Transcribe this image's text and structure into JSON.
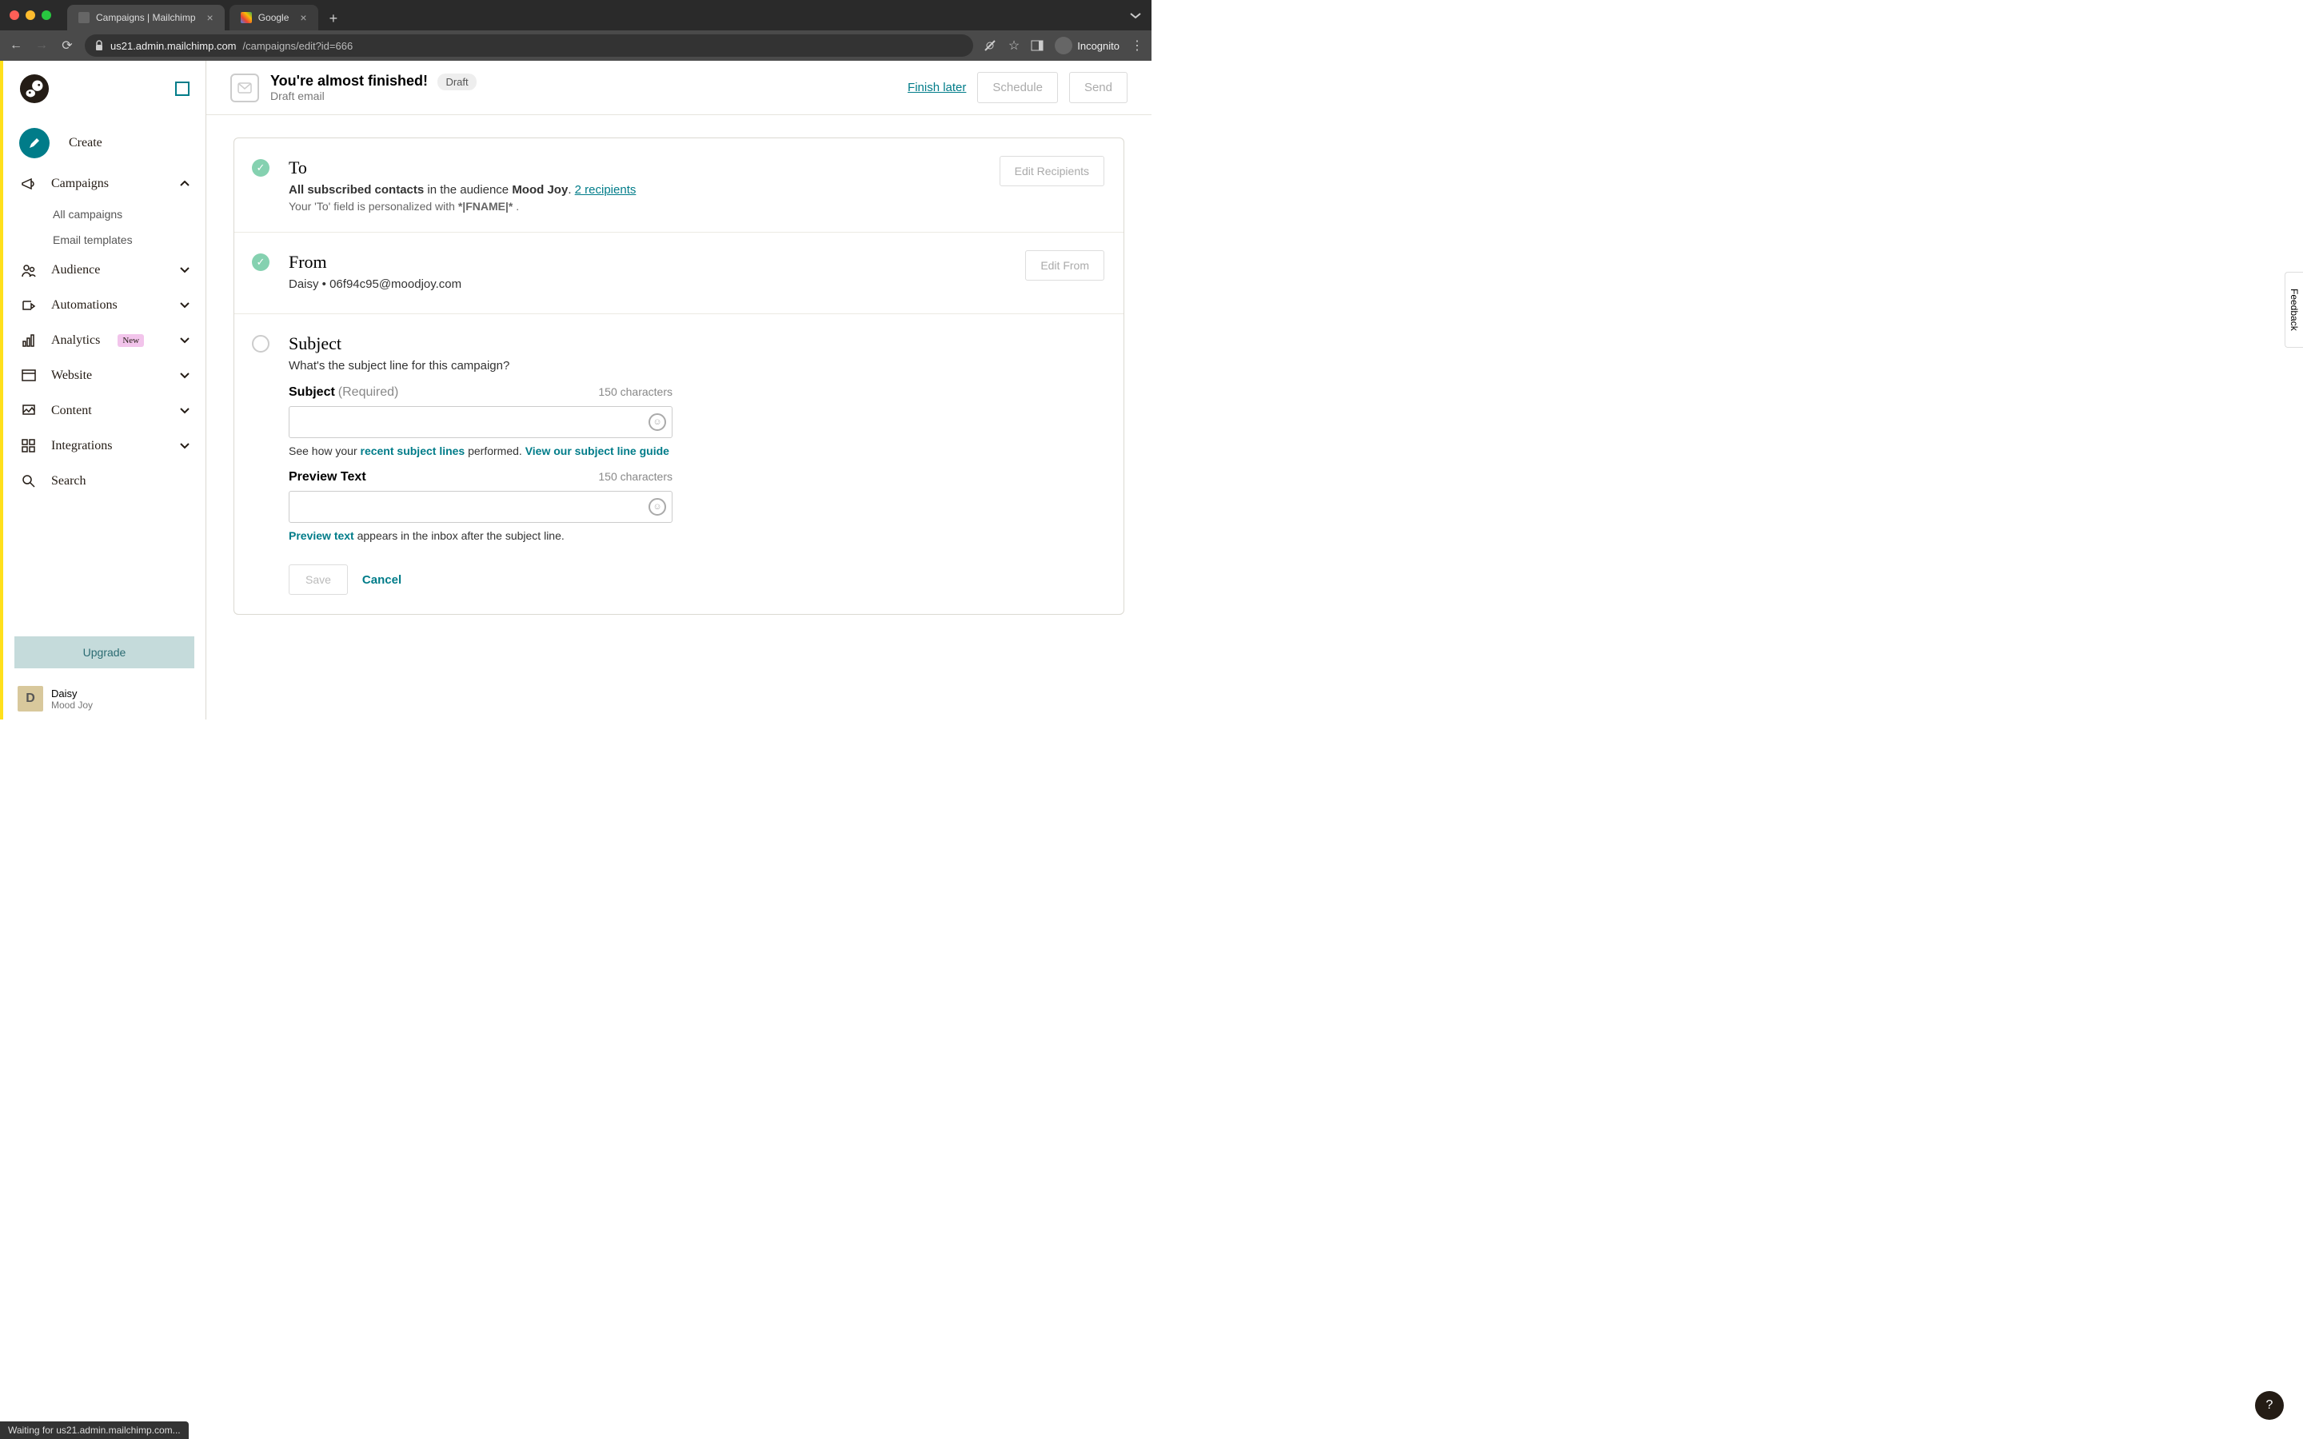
{
  "browser": {
    "tabs": [
      {
        "title": "Campaigns | Mailchimp",
        "active": true
      },
      {
        "title": "Google",
        "active": false
      }
    ],
    "url_prefix": "us21.admin.mailchimp.com",
    "url_path": "/campaigns/edit?id=666",
    "incognito": "Incognito"
  },
  "sidebar": {
    "create": "Create",
    "campaigns": "Campaigns",
    "campaigns_sub": [
      "All campaigns",
      "Email templates"
    ],
    "audience": "Audience",
    "automations": "Automations",
    "analytics": "Analytics",
    "analytics_badge": "New",
    "website": "Website",
    "content": "Content",
    "integrations": "Integrations",
    "search": "Search",
    "upgrade": "Upgrade",
    "user_initial": "D",
    "user_name": "Daisy",
    "user_org": "Mood Joy"
  },
  "header": {
    "title": "You're almost finished!",
    "badge": "Draft",
    "subtitle": "Draft email",
    "finish_later": "Finish later",
    "schedule": "Schedule",
    "send": "Send"
  },
  "to_section": {
    "title": "To",
    "prefix": "All subscribed contacts",
    "middle": " in the audience ",
    "audience": "Mood Joy",
    "dot": ". ",
    "recipients": "2 recipients",
    "note_prefix": "Your 'To' field is personalized with ",
    "note_token": "*|FNAME|*",
    "note_suffix": " .",
    "edit": "Edit Recipients"
  },
  "from_section": {
    "title": "From",
    "value": "Daisy • 06f94c95@moodjoy.com",
    "edit": "Edit From"
  },
  "subject_section": {
    "title": "Subject",
    "question": "What's the subject line for this campaign?",
    "subject_label": "Subject",
    "required": "(Required)",
    "char_limit": "150 characters",
    "subject_value": "",
    "help_prefix": "See how your ",
    "help_link1": "recent subject lines",
    "help_middle": " performed. ",
    "help_link2": "View our subject line guide",
    "preview_label": "Preview Text",
    "preview_value": "",
    "preview_link": "Preview text",
    "preview_rest": " appears in the inbox after the subject line.",
    "save": "Save",
    "cancel": "Cancel"
  },
  "feedback": "Feedback",
  "help": "?",
  "status": "Waiting for us21.admin.mailchimp.com..."
}
